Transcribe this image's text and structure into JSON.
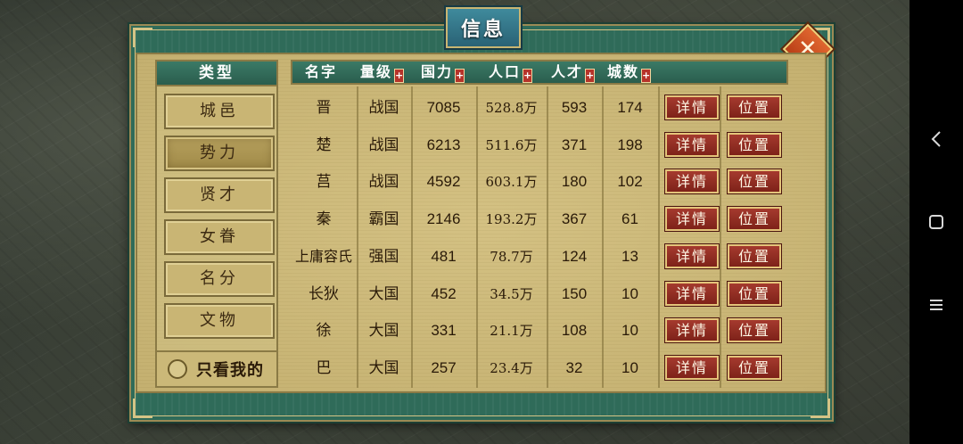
{
  "dialog": {
    "title": "信息",
    "close_label": "✕"
  },
  "categories": {
    "header": "类型",
    "items": [
      {
        "label": "城邑",
        "active": false
      },
      {
        "label": "势力",
        "active": true
      },
      {
        "label": "贤才",
        "active": false
      },
      {
        "label": "女眷",
        "active": false
      },
      {
        "label": "名分",
        "active": false
      },
      {
        "label": "文物",
        "active": false
      }
    ],
    "only_mine_label": "只看我的"
  },
  "table": {
    "headers": {
      "name": "名字",
      "level": "量级",
      "power": "国力",
      "population": "人口",
      "talent": "人才",
      "cities": "城数",
      "sort_symbol": "+"
    },
    "detail_label": "详情",
    "location_label": "位置",
    "rows": [
      {
        "name": "晋",
        "level": "战国",
        "power": "7085",
        "population": "528.8万",
        "talent": "593",
        "cities": "174"
      },
      {
        "name": "楚",
        "level": "战国",
        "power": "6213",
        "population": "511.6万",
        "talent": "371",
        "cities": "198"
      },
      {
        "name": "莒",
        "level": "战国",
        "power": "4592",
        "population": "603.1万",
        "talent": "180",
        "cities": "102"
      },
      {
        "name": "秦",
        "level": "霸国",
        "power": "2146",
        "population": "193.2万",
        "talent": "367",
        "cities": "61"
      },
      {
        "name": "上庸容氏",
        "level": "强国",
        "power": "481",
        "population": "78.7万",
        "talent": "124",
        "cities": "13"
      },
      {
        "name": "长狄",
        "level": "大国",
        "power": "452",
        "population": "34.5万",
        "talent": "150",
        "cities": "10"
      },
      {
        "name": "徐",
        "level": "大国",
        "power": "331",
        "population": "21.1万",
        "talent": "108",
        "cities": "10"
      },
      {
        "name": "巴",
        "level": "大国",
        "power": "257",
        "population": "23.4万",
        "talent": "32",
        "cities": "10"
      }
    ]
  },
  "navbar": {
    "back_icon": "back-icon",
    "home_icon": "home-icon",
    "menu_icon": "menu-icon"
  }
}
